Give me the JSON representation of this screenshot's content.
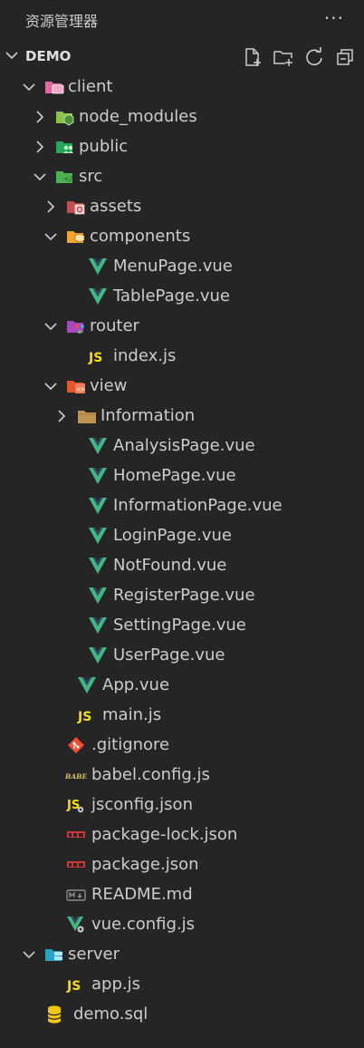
{
  "header": {
    "title": "资源管理器",
    "more": "···"
  },
  "section": {
    "name": "DEMO",
    "actions": [
      "new-file-icon",
      "new-folder-icon",
      "refresh-icon",
      "collapse-all-icon"
    ]
  },
  "tree": [
    {
      "label": "client",
      "depth": 0,
      "kind": "folder",
      "open": true,
      "icon": "client-folder-icon"
    },
    {
      "label": "node_modules",
      "depth": 1,
      "kind": "folder",
      "open": false,
      "icon": "node-folder-icon"
    },
    {
      "label": "public",
      "depth": 1,
      "kind": "folder",
      "open": false,
      "icon": "public-folder-icon"
    },
    {
      "label": "src",
      "depth": 1,
      "kind": "folder",
      "open": true,
      "icon": "src-folder-icon"
    },
    {
      "label": "assets",
      "depth": 2,
      "kind": "folder",
      "open": false,
      "icon": "assets-folder-icon"
    },
    {
      "label": "components",
      "depth": 2,
      "kind": "folder",
      "open": true,
      "icon": "components-folder-icon"
    },
    {
      "label": "MenuPage.vue",
      "depth": 3,
      "kind": "file",
      "icon": "vue-icon"
    },
    {
      "label": "TablePage.vue",
      "depth": 3,
      "kind": "file",
      "icon": "vue-icon"
    },
    {
      "label": "router",
      "depth": 2,
      "kind": "folder",
      "open": true,
      "icon": "router-folder-icon"
    },
    {
      "label": "index.js",
      "depth": 3,
      "kind": "file",
      "icon": "js-icon"
    },
    {
      "label": "view",
      "depth": 2,
      "kind": "folder",
      "open": true,
      "icon": "view-folder-icon"
    },
    {
      "label": "Information",
      "depth": 3,
      "kind": "folder",
      "open": false,
      "icon": "folder-icon"
    },
    {
      "label": "AnalysisPage.vue",
      "depth": 3,
      "kind": "file",
      "icon": "vue-icon"
    },
    {
      "label": "HomePage.vue",
      "depth": 3,
      "kind": "file",
      "icon": "vue-icon"
    },
    {
      "label": "InformationPage.vue",
      "depth": 3,
      "kind": "file",
      "icon": "vue-icon"
    },
    {
      "label": "LoginPage.vue",
      "depth": 3,
      "kind": "file",
      "icon": "vue-icon"
    },
    {
      "label": "NotFound.vue",
      "depth": 3,
      "kind": "file",
      "icon": "vue-icon"
    },
    {
      "label": "RegisterPage.vue",
      "depth": 3,
      "kind": "file",
      "icon": "vue-icon"
    },
    {
      "label": "SettingPage.vue",
      "depth": 3,
      "kind": "file",
      "icon": "vue-icon"
    },
    {
      "label": "UserPage.vue",
      "depth": 3,
      "kind": "file",
      "icon": "vue-icon"
    },
    {
      "label": "App.vue",
      "depth": 2,
      "kind": "file",
      "icon": "vue-icon"
    },
    {
      "label": "main.js",
      "depth": 2,
      "kind": "file",
      "icon": "js-icon"
    },
    {
      "label": ".gitignore",
      "depth": 1,
      "kind": "file",
      "icon": "git-icon"
    },
    {
      "label": "babel.config.js",
      "depth": 1,
      "kind": "file",
      "icon": "babel-icon"
    },
    {
      "label": "jsconfig.json",
      "depth": 1,
      "kind": "file",
      "icon": "jsconfig-icon"
    },
    {
      "label": "package-lock.json",
      "depth": 1,
      "kind": "file",
      "icon": "npm-icon"
    },
    {
      "label": "package.json",
      "depth": 1,
      "kind": "file",
      "icon": "npm-icon"
    },
    {
      "label": "README.md",
      "depth": 1,
      "kind": "file",
      "icon": "markdown-icon"
    },
    {
      "label": "vue.config.js",
      "depth": 1,
      "kind": "file",
      "icon": "vue-config-icon"
    },
    {
      "label": "server",
      "depth": 0,
      "kind": "folder",
      "open": true,
      "icon": "server-folder-icon"
    },
    {
      "label": "app.js",
      "depth": 1,
      "kind": "file",
      "icon": "js-icon"
    },
    {
      "label": "demo.sql",
      "depth": 0,
      "kind": "file",
      "icon": "database-icon"
    }
  ],
  "colors": {
    "background": "#252526",
    "text": "#cccccc",
    "vue_green": "#41b883",
    "vue_dark": "#35495e",
    "js_yellow": "#f5de19",
    "npm_red": "#cb3837",
    "git_red": "#f14e32",
    "folder_tan": "#c09553"
  }
}
